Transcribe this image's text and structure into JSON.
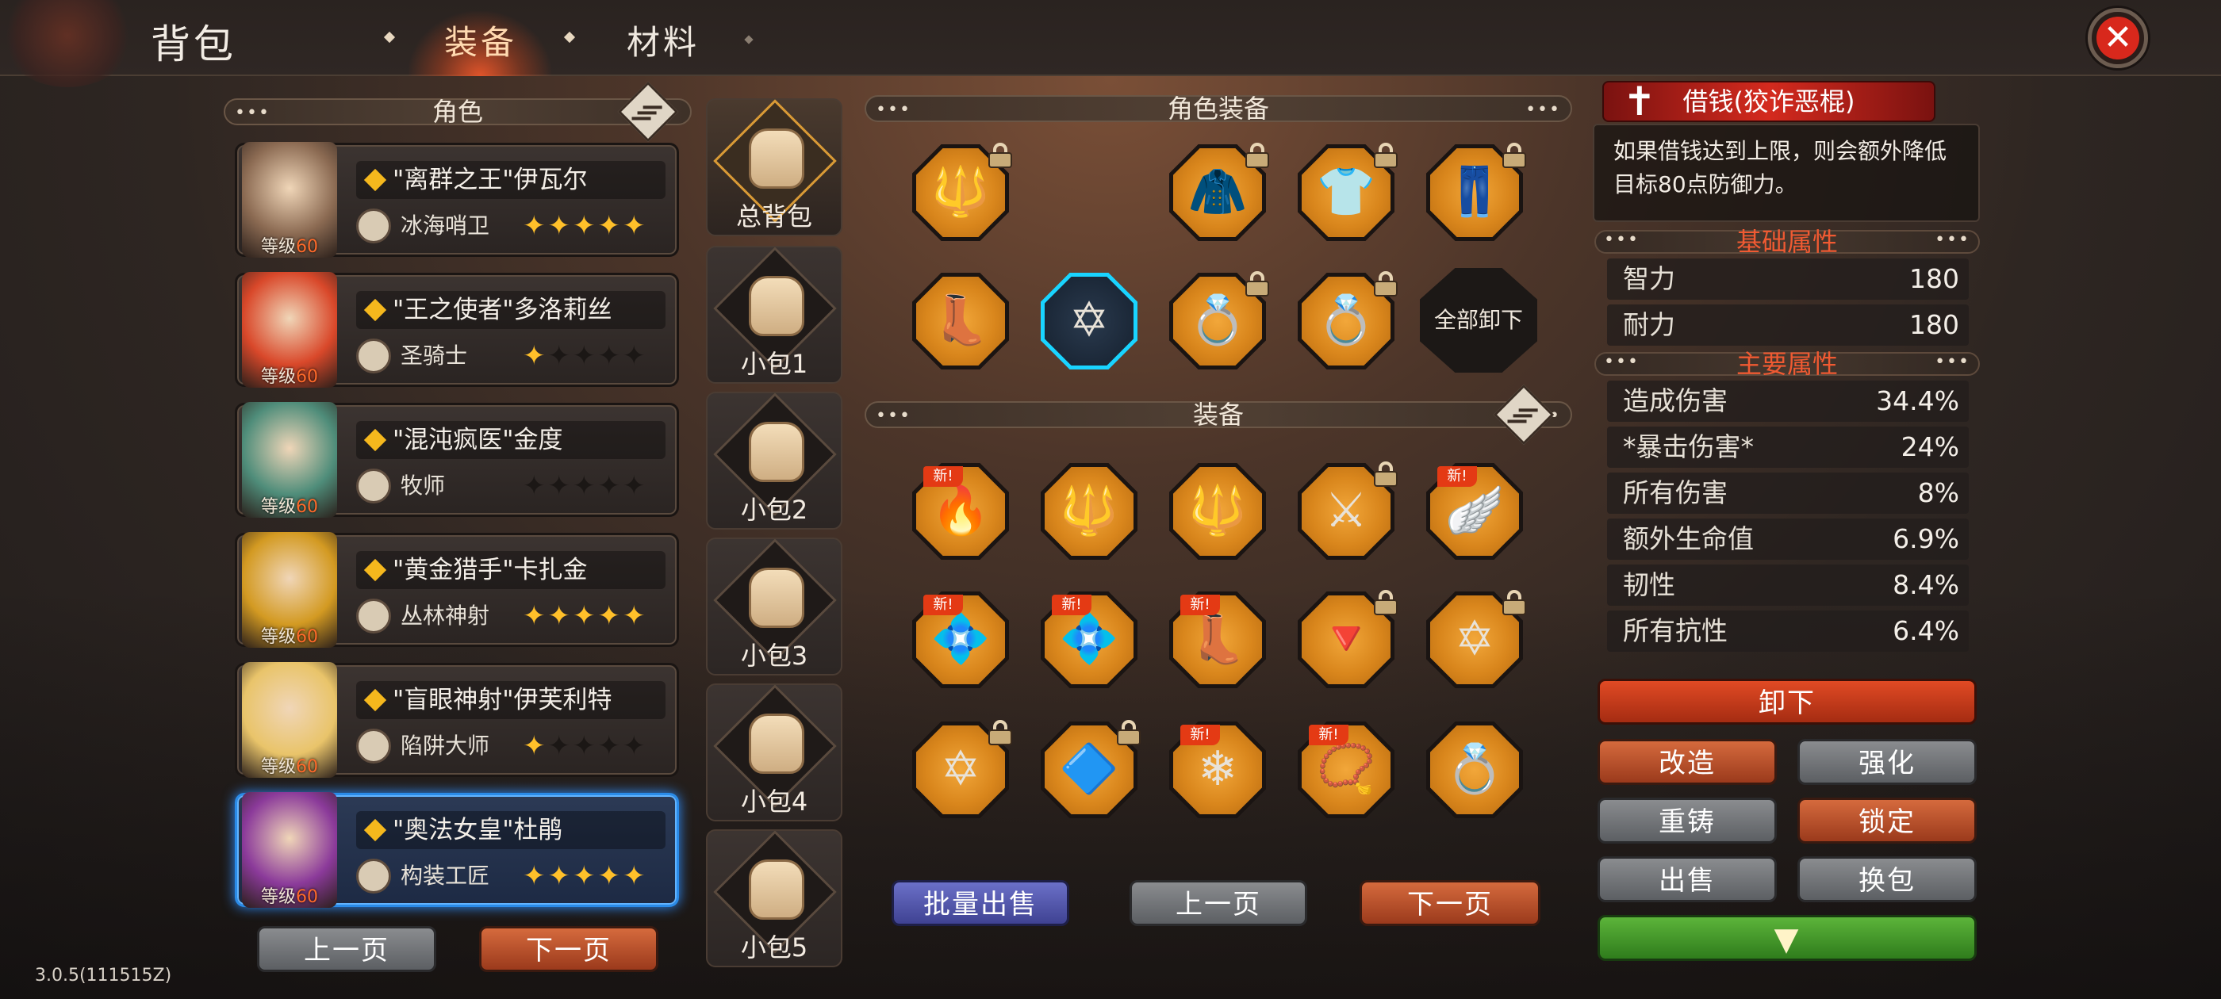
{
  "header": {
    "title": "背包",
    "tabs": [
      "装备",
      "材料"
    ],
    "active_tab": "装备"
  },
  "left": {
    "section_title": "角色",
    "characters": [
      {
        "name": "\"离群之王\"伊瓦尔",
        "class": "冰海哨卫",
        "stars": 5,
        "level_label": "等级",
        "level": "60",
        "color": "#8b6a52"
      },
      {
        "name": "\"王之使者\"多洛莉丝",
        "class": "圣骑士",
        "stars": 1,
        "level_label": "等级",
        "level": "60",
        "color": "#d9482a"
      },
      {
        "name": "\"混沌疯医\"金度",
        "class": "牧师",
        "stars": 0,
        "level_label": "等级",
        "level": "60",
        "color": "#4f8d7a"
      },
      {
        "name": "\"黄金猎手\"卡扎金",
        "class": "丛林神射",
        "stars": 5,
        "level_label": "等级",
        "level": "60",
        "color": "#d39a22"
      },
      {
        "name": "\"盲眼神射\"伊芙利特",
        "class": "陷阱大师",
        "stars": 1,
        "level_label": "等级",
        "level": "60",
        "color": "#e9c46a"
      },
      {
        "name": "\"奥法女皇\"杜鹃",
        "class": "构装工匠",
        "stars": 5,
        "level_label": "等级",
        "level": "60",
        "color": "#8b3a9a"
      }
    ],
    "prev": "上一页",
    "next": "下一页"
  },
  "bags": [
    "总背包",
    "小包1",
    "小包2",
    "小包3",
    "小包4",
    "小包5"
  ],
  "char_equip": {
    "title": "角色装备",
    "row1": [
      {
        "icon": "🔱",
        "name": "staff-icon",
        "locked": true
      },
      {
        "icon": "",
        "name": "empty-slot",
        "locked": false
      },
      {
        "icon": "🧥",
        "name": "hood-icon",
        "locked": true
      },
      {
        "icon": "👕",
        "name": "shirt-icon",
        "locked": true
      },
      {
        "icon": "👖",
        "name": "pants-icon",
        "locked": true
      }
    ],
    "row2": [
      {
        "icon": "👢",
        "name": "boots-icon",
        "locked": false
      },
      {
        "icon": "✡",
        "name": "hexagram-icon",
        "locked": false,
        "selected": true
      },
      {
        "icon": "💍",
        "name": "ring-icon",
        "locked": true
      },
      {
        "icon": "💍",
        "name": "gem-ring-icon",
        "locked": true
      }
    ],
    "unequip_all": "全部卸下"
  },
  "equip": {
    "title": "装备",
    "new_tag": "新!",
    "rows": [
      [
        {
          "icon": "🔥",
          "new": true,
          "locked": false
        },
        {
          "icon": "🔱",
          "new": false,
          "locked": false
        },
        {
          "icon": "🔱",
          "new": false,
          "locked": false
        },
        {
          "icon": "⚔",
          "new": false,
          "locked": true
        },
        {
          "icon": "🪽",
          "new": true,
          "locked": false
        }
      ],
      [
        {
          "icon": "💠",
          "new": true,
          "locked": false
        },
        {
          "icon": "💠",
          "new": true,
          "locked": false
        },
        {
          "icon": "👢",
          "new": true,
          "locked": false
        },
        {
          "icon": "🔻",
          "new": false,
          "locked": true
        },
        {
          "icon": "✡",
          "new": false,
          "locked": true
        }
      ],
      [
        {
          "icon": "✡",
          "new": false,
          "locked": true
        },
        {
          "icon": "🔷",
          "new": false,
          "locked": true
        },
        {
          "icon": "❄",
          "new": true,
          "locked": false
        },
        {
          "icon": "📿",
          "new": true,
          "locked": false
        },
        {
          "icon": "💍",
          "new": false,
          "locked": false
        }
      ]
    ],
    "batch_sell": "批量出售",
    "prev": "上一页",
    "next": "下一页"
  },
  "right": {
    "skill_name": "借钱(狡诈恶棍)",
    "skill_desc": "如果借钱达到上限，则会额外降低目标80点防御力。",
    "base_title": "基础属性",
    "base": [
      {
        "k": "智力",
        "v": "180"
      },
      {
        "k": "耐力",
        "v": "180"
      }
    ],
    "main_title": "主要属性",
    "main": [
      {
        "k": "造成伤害",
        "v": "34.4%"
      },
      {
        "k": "*暴击伤害*",
        "v": "24%"
      },
      {
        "k": "所有伤害",
        "v": "8%"
      },
      {
        "k": "额外生命值",
        "v": "6.9%"
      },
      {
        "k": "韧性",
        "v": "8.4%"
      },
      {
        "k": "所有抗性",
        "v": "6.4%"
      }
    ],
    "buttons": {
      "unequip": "卸下",
      "reforge": "改造",
      "enhance": "强化",
      "recast": "重铸",
      "lock": "锁定",
      "sell": "出售",
      "swap": "换包"
    }
  },
  "version": "3.0.5(111515Z)"
}
